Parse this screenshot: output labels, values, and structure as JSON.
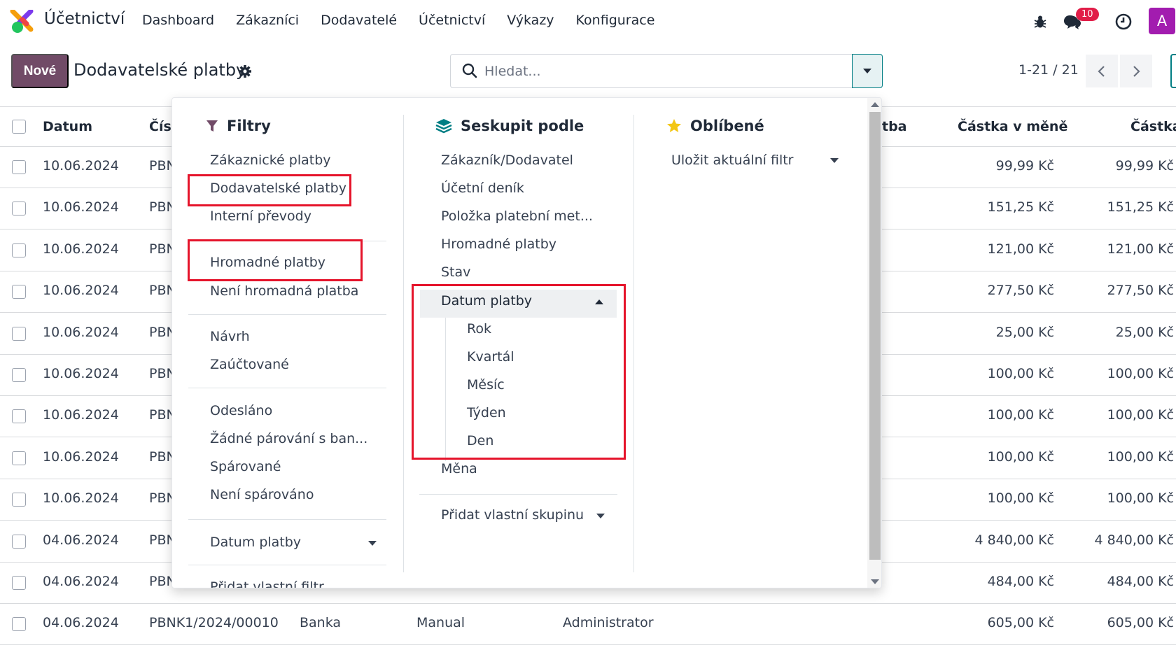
{
  "navbar": {
    "app_name": "Účetnictví",
    "menu": [
      "Dashboard",
      "Zákazníci",
      "Dodavatelé",
      "Účetnictví",
      "Výkazy",
      "Konfigurace"
    ],
    "messages_badge": "10",
    "avatar_letter": "A"
  },
  "control_panel": {
    "new_label": "Nové",
    "title": "Dodavatelské platby",
    "search_placeholder": "Hledat...",
    "pager": "1-21 / 21"
  },
  "table": {
    "headers": [
      "Datum",
      "Čísl",
      "tba",
      "Částka v měně",
      "Částka"
    ],
    "rows": [
      {
        "date": "10.06.2024",
        "number": "PBN",
        "amount_currency": "99,99 Kč",
        "amount": "99,99 Kč"
      },
      {
        "date": "10.06.2024",
        "number": "PBN",
        "amount_currency": "151,25 Kč",
        "amount": "151,25 Kč"
      },
      {
        "date": "10.06.2024",
        "number": "PBN",
        "amount_currency": "121,00 Kč",
        "amount": "121,00 Kč"
      },
      {
        "date": "10.06.2024",
        "number": "PBN",
        "amount_currency": "277,50 Kč",
        "amount": "277,50 Kč"
      },
      {
        "date": "10.06.2024",
        "number": "PBN",
        "amount_currency": "25,00 Kč",
        "amount": "25,00 Kč"
      },
      {
        "date": "10.06.2024",
        "number": "PBN",
        "amount_currency": "100,00 Kč",
        "amount": "100,00 Kč"
      },
      {
        "date": "10.06.2024",
        "number": "PBN",
        "amount_currency": "100,00 Kč",
        "amount": "100,00 Kč"
      },
      {
        "date": "10.06.2024",
        "number": "PBN",
        "amount_currency": "100,00 Kč",
        "amount": "100,00 Kč"
      },
      {
        "date": "10.06.2024",
        "number": "PBN",
        "amount_currency": "100,00 Kč",
        "amount": "100,00 Kč"
      },
      {
        "date": "04.06.2024",
        "number": "PBN",
        "amount_currency": "4 840,00 Kč",
        "amount": "4 840,00 Kč"
      },
      {
        "date": "04.06.2024",
        "number": "PBN",
        "amount_currency": "484,00 Kč",
        "amount": "484,00 Kč"
      },
      {
        "date": "04.06.2024",
        "number": "PBNK1/2024/00010",
        "journal": "Banka",
        "method": "Manual",
        "user": "Administrator",
        "amount_currency": "605,00 Kč",
        "amount": "605,00 Kč"
      }
    ]
  },
  "dropdown": {
    "filters": {
      "title": "Filtry",
      "items": [
        "Zákaznické platby",
        "Dodavatelské platby",
        "Interní převody",
        "Hromadné platby",
        "Není hromadná platba",
        "Návrh",
        "Zaúčtované",
        "Odesláno",
        "Žádné párování s ban...",
        "Spárované",
        "Není spárováno",
        "Datum platby",
        "Přidat vlastní filtr"
      ]
    },
    "group_by": {
      "title": "Seskupit podle",
      "items": [
        "Zákazník/Dodavatel",
        "Účetní deník",
        "Položka platební met...",
        "Hromadné platby",
        "Stav",
        "Datum platby",
        "Rok",
        "Kvartál",
        "Měsíc",
        "Týden",
        "Den",
        "Měna",
        "Přidat vlastní skupinu"
      ]
    },
    "favorites": {
      "title": "Oblíbené",
      "items": [
        "Uložit aktuální filtr"
      ]
    }
  },
  "colors": {
    "brand": "#714B67",
    "accent": "#017e84",
    "highlight_box": "#e5142b",
    "badge": "#e11d48",
    "avatar": "#a21caf"
  }
}
